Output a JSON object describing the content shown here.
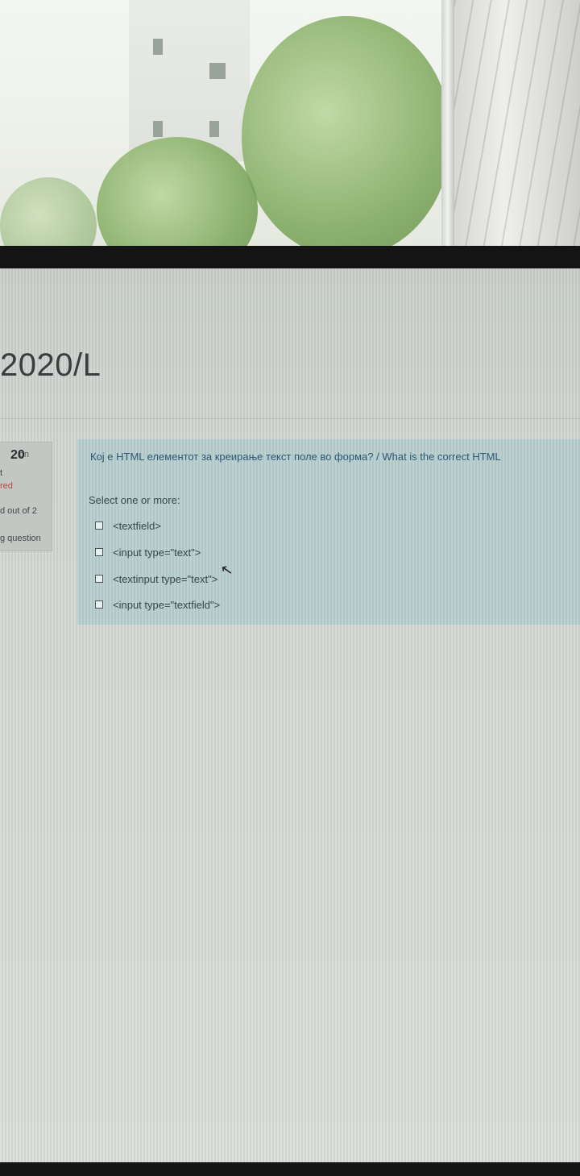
{
  "course": {
    "title_fragment": "2020/L"
  },
  "question_info": {
    "number_label": "on",
    "number": "20",
    "status_line": "t",
    "state": "red",
    "mark": "d out of 2",
    "flag": "g question"
  },
  "question": {
    "text": "Кој е HTML елементот за креирање текст поле во форма? / What is the correct HTML",
    "prompt": "Select one or more:",
    "options": [
      {
        "label": "<textfield>"
      },
      {
        "label": "<input type=\"text\">"
      },
      {
        "label": "<textinput type=\"text\">"
      },
      {
        "label": "<input type=\"textfield\">"
      }
    ]
  }
}
